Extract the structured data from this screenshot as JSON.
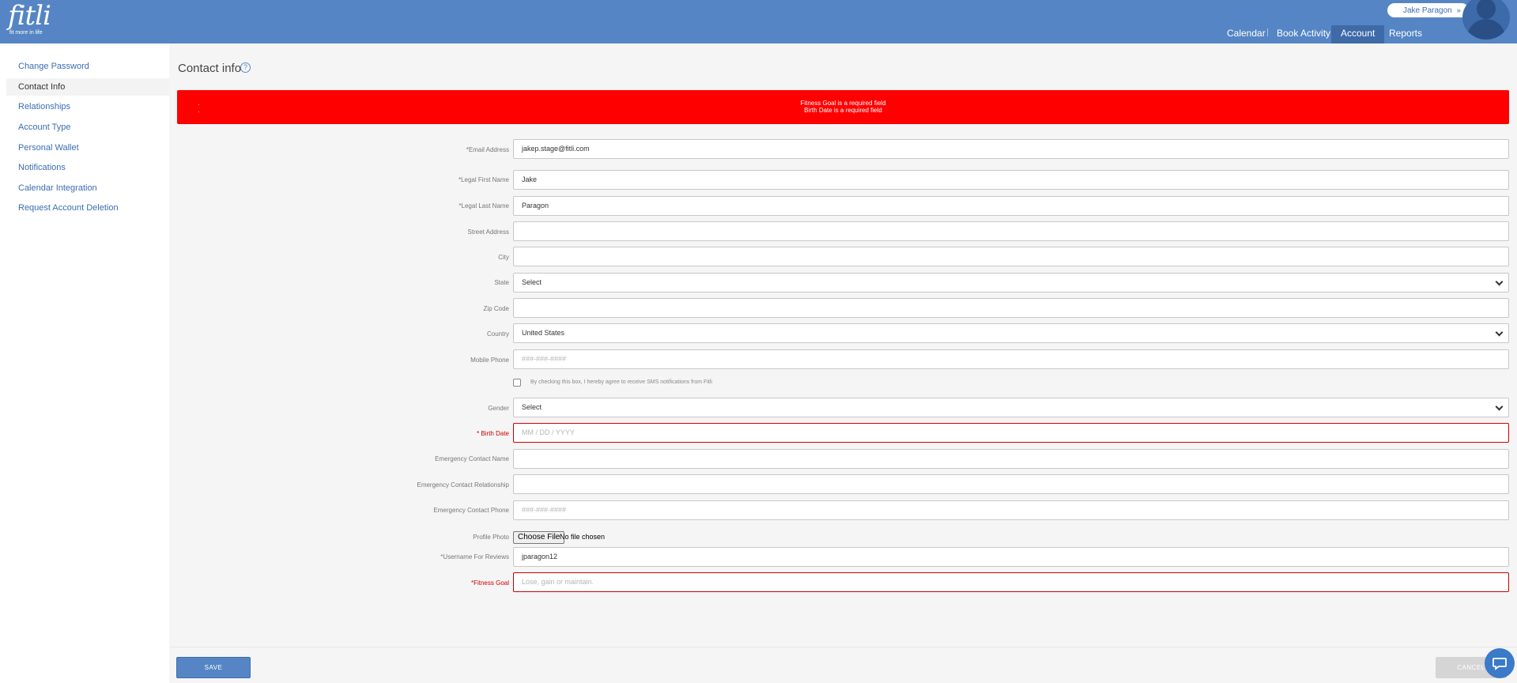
{
  "header": {
    "logo": "fitli",
    "tagline": "fit more in life",
    "user_name": "Jake Paragon",
    "user_chevron": "»",
    "nav": [
      "Calendar",
      "Book Activity",
      "Account",
      "Reports"
    ],
    "nav_active": "Account",
    "colors": {
      "bar": "#5585c4",
      "active_tab": "#3e6aa7"
    }
  },
  "sidebar": {
    "items": [
      {
        "label": "Change Password"
      },
      {
        "label": "Contact Info",
        "active": true
      },
      {
        "label": "Relationships"
      },
      {
        "label": "Account Type"
      },
      {
        "label": "Personal Wallet"
      },
      {
        "label": "Notifications"
      },
      {
        "label": "Calendar Integration"
      },
      {
        "label": "Request Account Deletion"
      }
    ]
  },
  "page": {
    "title": "Contact info",
    "help_icon": "question-circle-icon",
    "help_glyph": "?"
  },
  "alert": {
    "color": "#ff0000",
    "bullets": [
      "·",
      "·"
    ],
    "messages": [
      "Fitness Goal is a required field",
      "Birth Date is a required field"
    ]
  },
  "form": {
    "email": {
      "label": "*Email Address",
      "value": "jakep.stage@fitli.com"
    },
    "first_name": {
      "label": "*Legal First Name",
      "value": "Jake"
    },
    "last_name": {
      "label": "*Legal Last Name",
      "value": "Paragon"
    },
    "street": {
      "label": "Street Address",
      "value": ""
    },
    "city": {
      "label": "City",
      "value": ""
    },
    "state": {
      "label": "State",
      "value": "Select"
    },
    "zip": {
      "label": "Zip Code",
      "value": ""
    },
    "country": {
      "label": "Country",
      "value": "United States"
    },
    "mobile": {
      "label": "Mobile Phone",
      "placeholder": "###-###-####"
    },
    "sms_consent": {
      "label": "By checking this box, I hereby agree to receive SMS notifications from Fitli",
      "checked": false
    },
    "gender": {
      "label": "Gender",
      "value": "Select"
    },
    "birth_date": {
      "label": "* Birth Date",
      "placeholder": "MM / DD / YYYY",
      "error": true
    },
    "emergency_name": {
      "label": "Emergency Contact Name",
      "value": ""
    },
    "emergency_relationship": {
      "label": "Emergency Contact Relationship",
      "value": ""
    },
    "emergency_phone": {
      "label": "Emergency Contact Phone",
      "placeholder": "###-###-####"
    },
    "profile_photo": {
      "label": "Profile Photo",
      "button": "Choose File",
      "status": "No file chosen"
    },
    "username": {
      "label": "*Username For Reviews",
      "value": "jparagon12"
    },
    "fitness_goal": {
      "label": "*Fitness Goal",
      "placeholder": "Lose, gain or maintain.",
      "error": true
    }
  },
  "footer": {
    "save": "SAVE",
    "cancel": "CANCEL"
  },
  "chat": {
    "icon": "chat-bubble-icon"
  }
}
